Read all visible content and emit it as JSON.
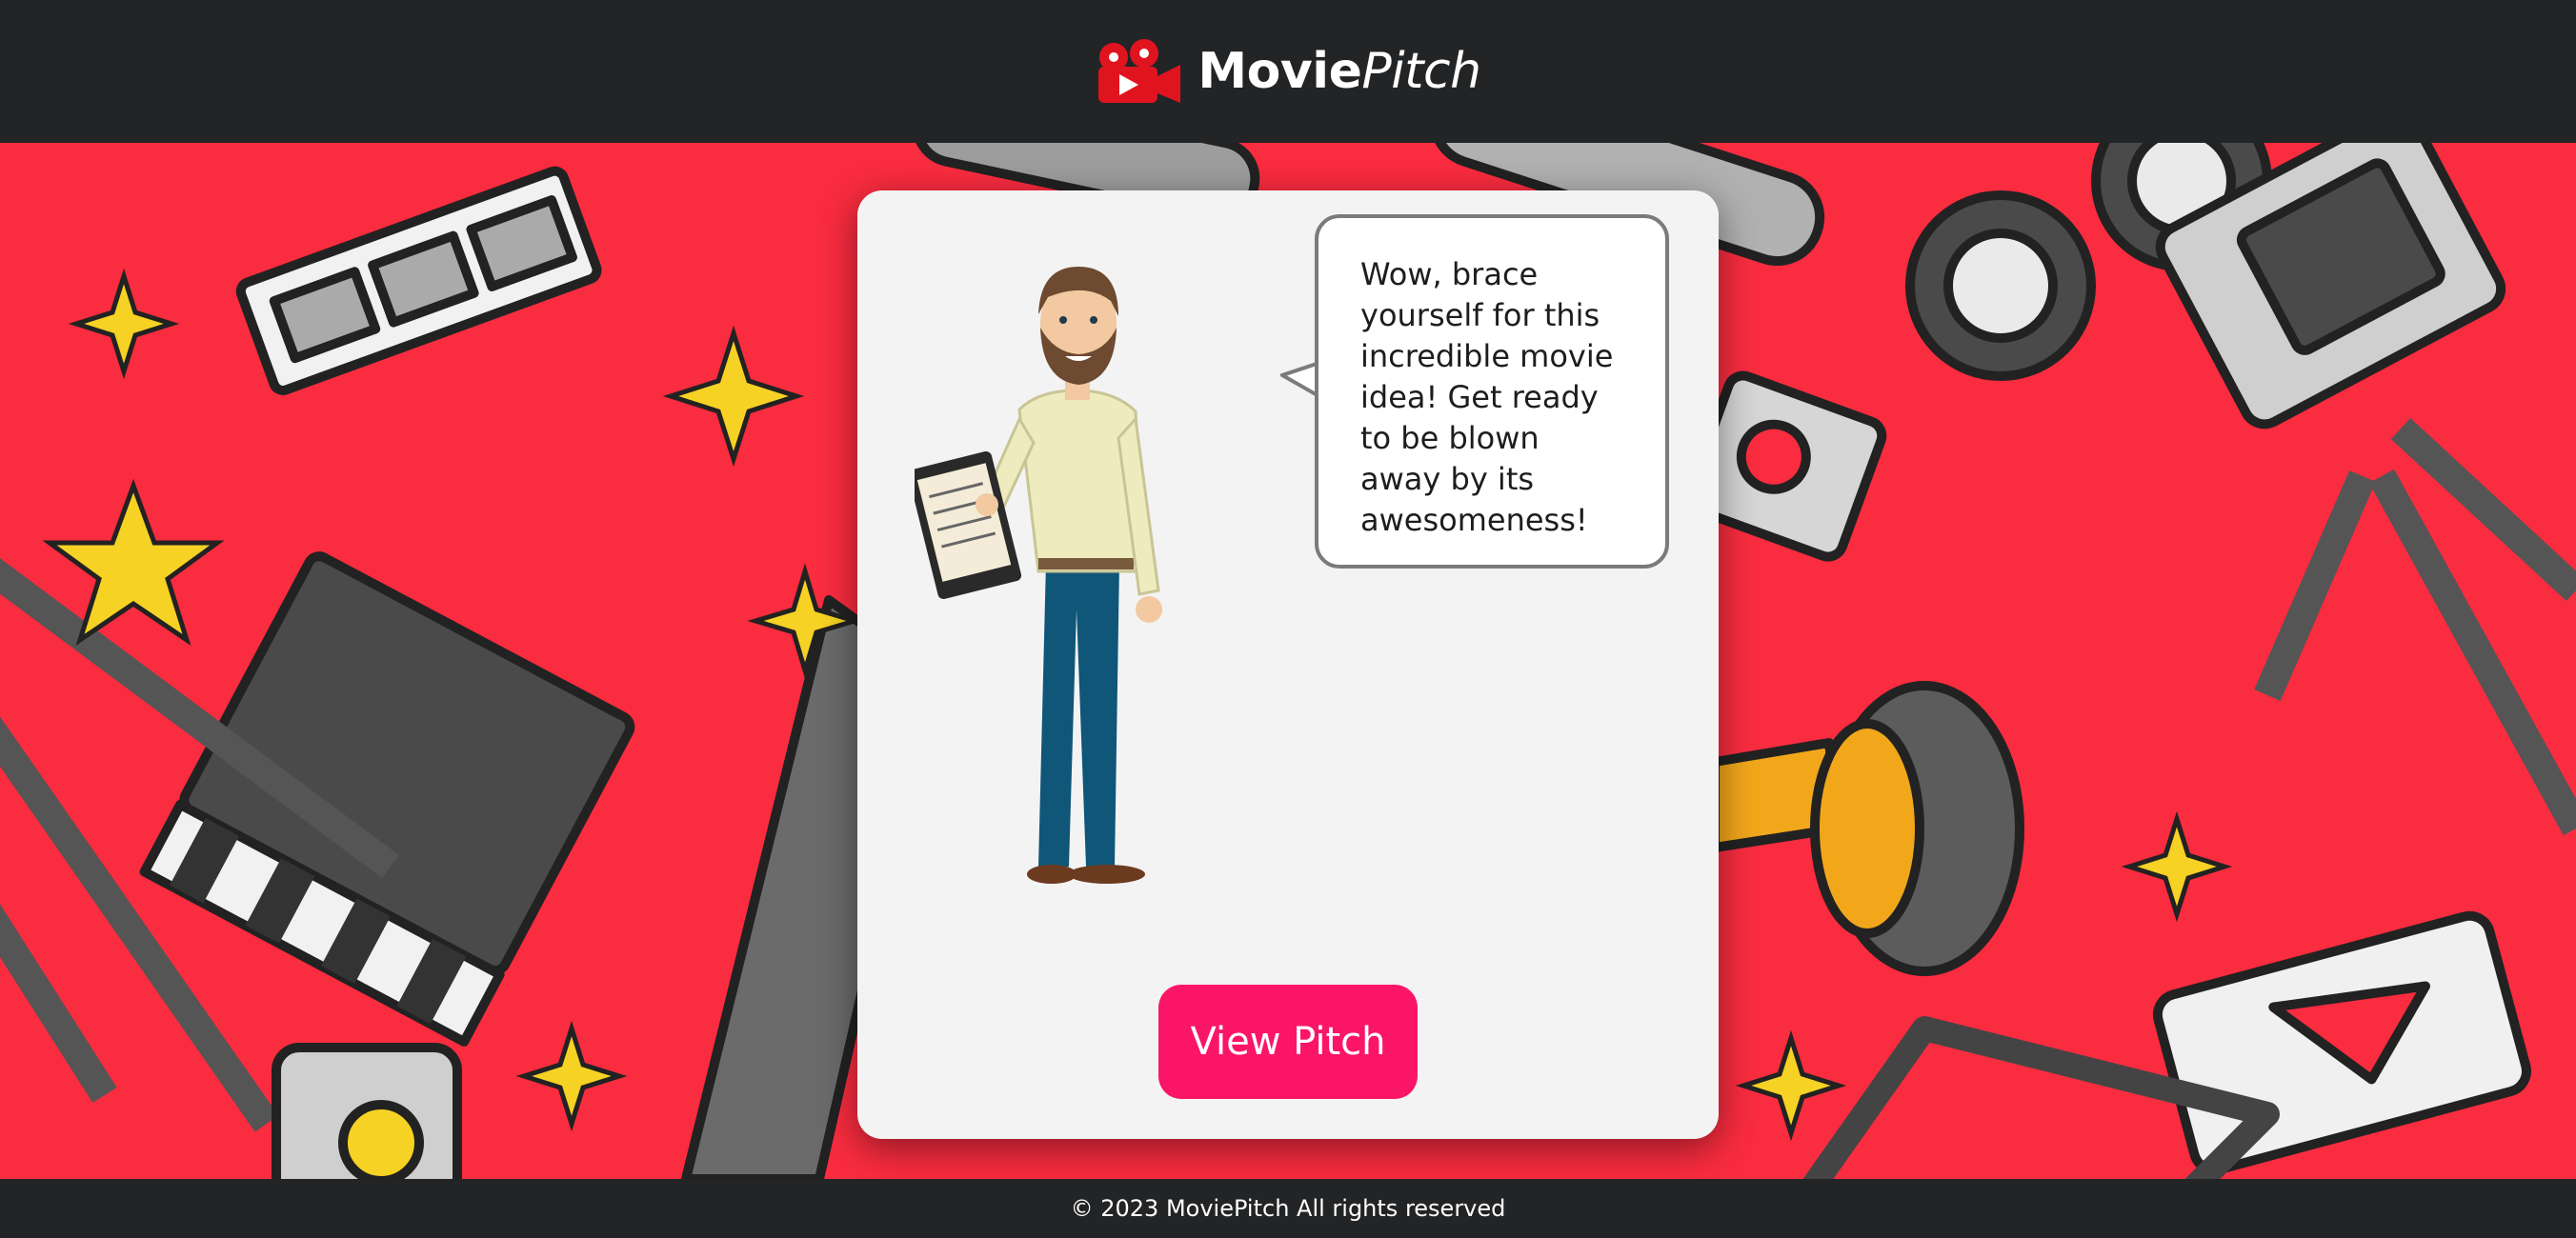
{
  "header": {
    "brand_bold": "Movie",
    "brand_italic": "Pitch",
    "logo_icon": "movie-camera-icon"
  },
  "card": {
    "speech_text": "Wow, brace yourself for this incredible movie idea! Get ready to be blown away by its awesomeness!",
    "button_label": "View Pitch"
  },
  "footer": {
    "copyright": "© 2023 MoviePitch All rights reserved"
  },
  "colors": {
    "header_bg": "#232426",
    "background_red": "#fa2c3f",
    "card_bg": "#f3f3f3",
    "button_pink": "#fb1567",
    "logo_red": "#e0141f"
  }
}
